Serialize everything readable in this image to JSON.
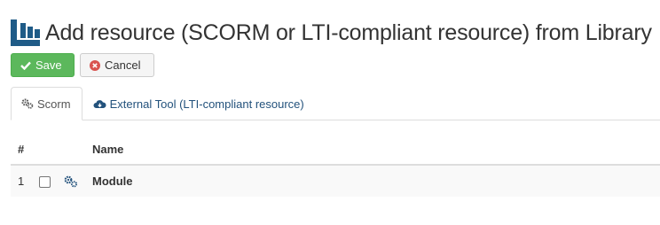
{
  "page": {
    "title": "Add resource (SCORM or LTI-compliant resource) from Library"
  },
  "toolbar": {
    "save_label": "Save",
    "cancel_label": "Cancel"
  },
  "tabs": [
    {
      "label": "Scorm",
      "icon": "cogs-icon",
      "active": true
    },
    {
      "label": "External Tool (LTI-compliant resource)",
      "icon": "cloud-download-icon",
      "active": false
    }
  ],
  "table": {
    "headers": {
      "num": "#",
      "name": "Name"
    },
    "rows": [
      {
        "num": "1",
        "name": "Module",
        "checked": false,
        "icon": "cogs-icon"
      }
    ]
  },
  "colors": {
    "brand": "#1f5b87",
    "save": "#5cb85c",
    "cancel_icon": "#d9534f",
    "link": "#23527c"
  }
}
